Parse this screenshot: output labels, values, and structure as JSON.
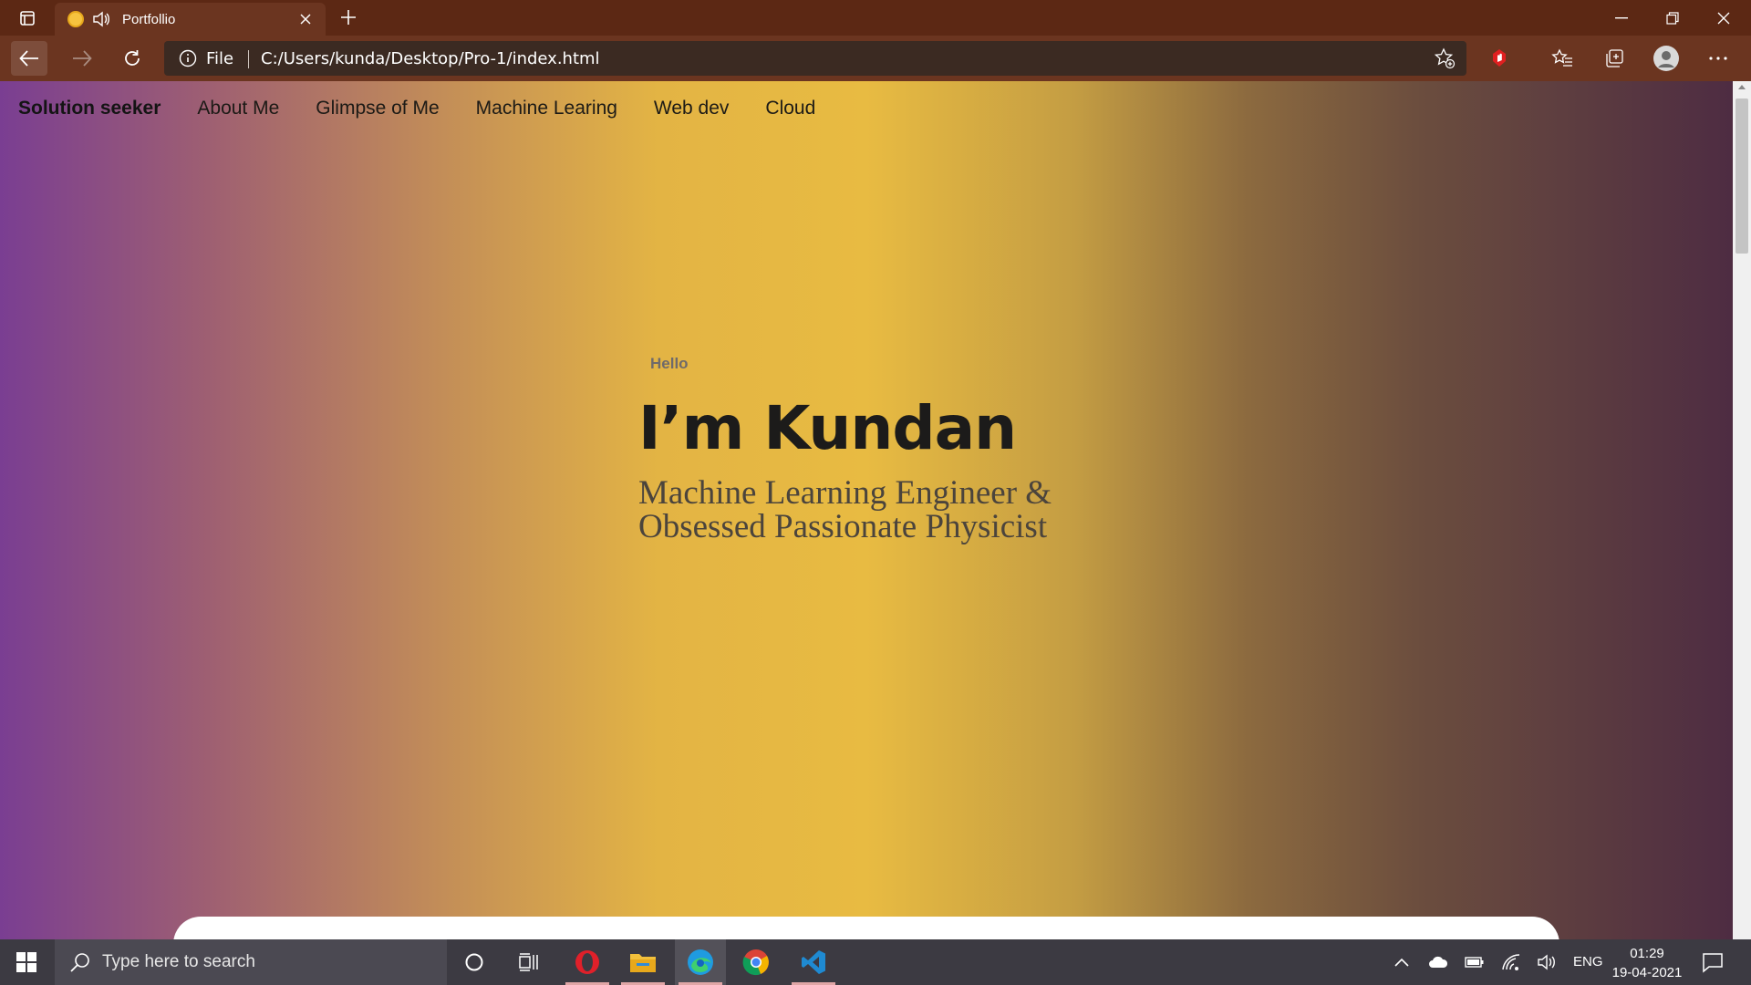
{
  "browser": {
    "tab": {
      "title": "Portfollio"
    },
    "address": {
      "scheme_label": "File",
      "url": "C:/Users/kunda/Desktop/Pro-1/index.html"
    }
  },
  "site": {
    "brand": "Solution seeker",
    "nav": [
      "About Me",
      "Glimpse of Me",
      "Machine Learing",
      "Web dev",
      "Cloud"
    ],
    "hero": {
      "eyebrow": "Hello",
      "title": "I’m Kundan",
      "subtitle_line1": "Machine Learning Engineer &",
      "subtitle_line2": "Obsessed Passionate Physicist"
    },
    "gradient_colors": [
      "#7a3e92",
      "#e8bb42",
      "#4e2c42"
    ]
  },
  "taskbar": {
    "search_placeholder": "Type here to search",
    "language": "ENG",
    "time": "01:29",
    "date": "19-04-2021",
    "pinned": [
      "cortana-icon",
      "task-view-icon",
      "opera-icon",
      "file-explorer-icon",
      "edge-icon",
      "chrome-icon",
      "vscode-icon"
    ]
  }
}
